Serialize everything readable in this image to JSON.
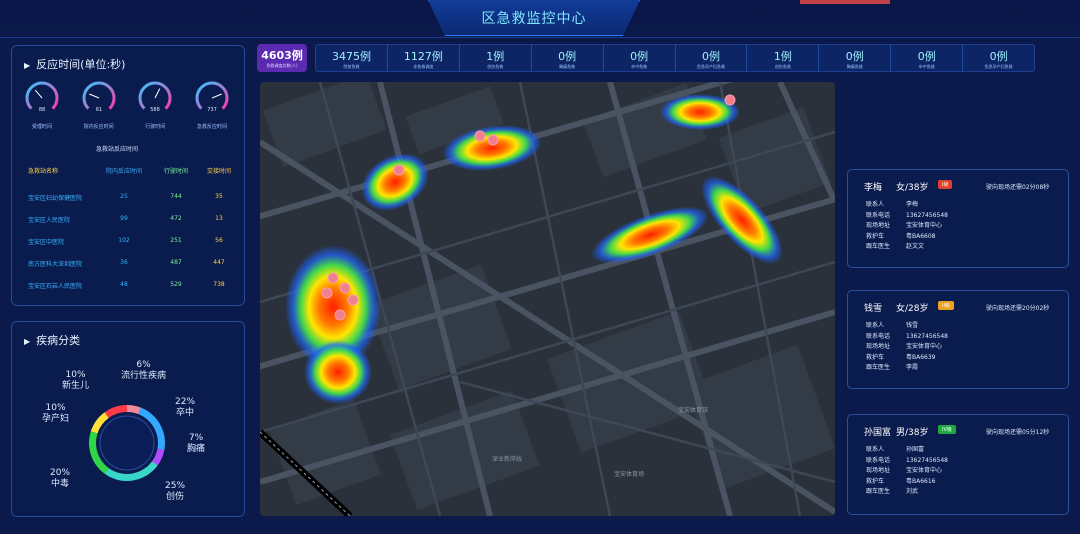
{
  "header": {
    "title": "区急救监控中心"
  },
  "response_panel": {
    "title": "反应时间(单位:秒)",
    "gauges": [
      {
        "value": "88",
        "label": "受理时间",
        "level": 0.35
      },
      {
        "value": "61",
        "label": "院内反应时间",
        "level": 0.25
      },
      {
        "value": "588",
        "label": "行驶时间",
        "level": 0.6
      },
      {
        "value": "737",
        "label": "急救反应时间",
        "level": 0.75
      }
    ],
    "table_title": "急救站反应时间",
    "headers": [
      "急救站名称",
      "院内反应时间",
      "行驶时间",
      "交接时间"
    ],
    "rows": [
      [
        "宝安区妇幼保健医院",
        "25",
        "744",
        "35"
      ],
      [
        "宝安区人民医院",
        "99",
        "472",
        "13"
      ],
      [
        "宝安区中医院",
        "102",
        "251",
        "56"
      ],
      [
        "南方医科大深圳医院",
        "36",
        "487",
        "447"
      ],
      [
        "宝安区石岩人民医院",
        "48",
        "529",
        "738"
      ]
    ]
  },
  "disease_panel": {
    "title": "疾病分类",
    "slices": [
      {
        "pct": "6%",
        "name": "流行性疾病",
        "value": 6,
        "color": "#f08a9a"
      },
      {
        "pct": "22%",
        "name": "卒中",
        "value": 22,
        "color": "#34a8ff"
      },
      {
        "pct": "7%",
        "name": "胸痛",
        "value": 7,
        "color": "#b04cff"
      },
      {
        "pct": "25%",
        "name": "创伤",
        "value": 25,
        "color": "#38d6c8"
      },
      {
        "pct": "20%",
        "name": "中毒",
        "value": 20,
        "color": "#2fd64a"
      },
      {
        "pct": "10%",
        "name": "孕产妇",
        "value": 10,
        "color": "#ffe13a"
      },
      {
        "pct": "10%",
        "name": "新生儿",
        "value": 10,
        "color": "#ff3b4a"
      }
    ]
  },
  "stats": {
    "first": {
      "value": "4603例",
      "label": "急救调度总数(人)"
    },
    "items": [
      {
        "value": "3475例",
        "label": "院前急救"
      },
      {
        "value": "1127例",
        "label": "非急救调度"
      },
      {
        "value": "1例",
        "label": "创伤急救"
      },
      {
        "value": "0例",
        "label": "胸痛急救"
      },
      {
        "value": "0例",
        "label": "卒中急救"
      },
      {
        "value": "0例",
        "label": "危急孕产妇急救"
      },
      {
        "value": "1例",
        "label": "创伤急救"
      },
      {
        "value": "0例",
        "label": "胸痛急救"
      },
      {
        "value": "0例",
        "label": "卒中急救"
      },
      {
        "value": "0例",
        "label": "危急孕产妇急救"
      }
    ]
  },
  "map": {
    "labels": [
      "宝安体育馆",
      "宝安体育场",
      "深业新岸线"
    ]
  },
  "patients": [
    {
      "name": "李梅",
      "gender_age": "女/38岁",
      "level": "I级",
      "level_color": "#e0402a",
      "eta": "驶向现场还需02分08秒",
      "fields": [
        [
          "联系人",
          "李梅"
        ],
        [
          "联系电话",
          "13627456548"
        ],
        [
          "现场地址",
          "宝安体育中心"
        ],
        [
          "救护车",
          "粤BA6608"
        ],
        [
          "跟车医生",
          "赵文文"
        ]
      ]
    },
    {
      "name": "钱雪",
      "gender_age": "女/28岁",
      "level": "II级",
      "level_color": "#f0a020",
      "eta": "驶向现场还需20分02秒",
      "fields": [
        [
          "联系人",
          "钱雪"
        ],
        [
          "联系电话",
          "13627456548"
        ],
        [
          "现场地址",
          "宝安体育中心"
        ],
        [
          "救护车",
          "粤BA6639"
        ],
        [
          "跟车医生",
          "李霞"
        ]
      ]
    },
    {
      "name": "孙国富",
      "gender_age": "男/38岁",
      "level": "IV级",
      "level_color": "#1fa840",
      "eta": "驶向现场还需05分12秒",
      "fields": [
        [
          "联系人",
          "孙国富"
        ],
        [
          "联系电话",
          "13627456548"
        ],
        [
          "现场地址",
          "宝安体育中心"
        ],
        [
          "救护车",
          "粤BA6616"
        ],
        [
          "跟车医生",
          "刘武"
        ]
      ]
    }
  ]
}
